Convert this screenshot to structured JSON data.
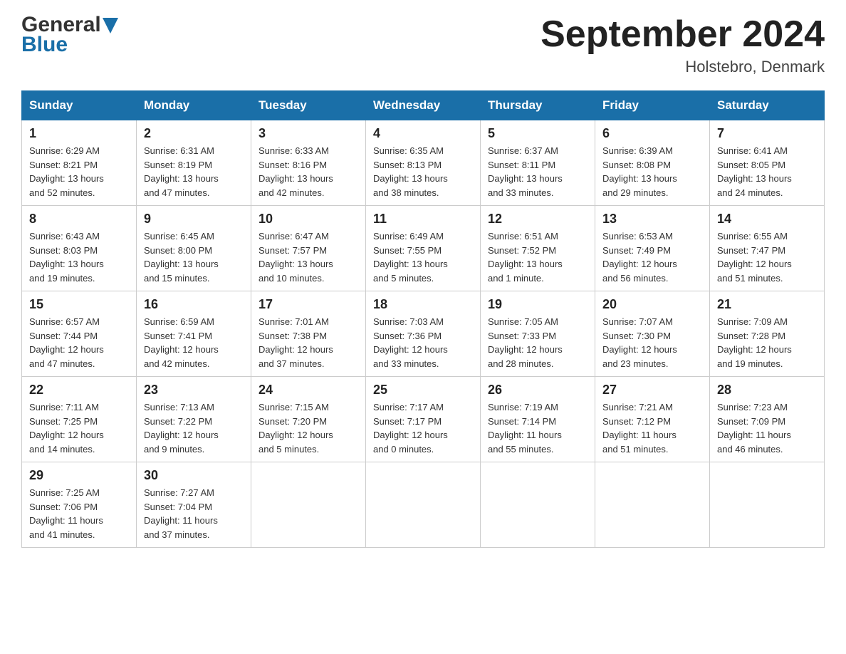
{
  "header": {
    "logo_line1": "General",
    "logo_line2": "Blue",
    "title": "September 2024",
    "location": "Holstebro, Denmark"
  },
  "weekdays": [
    "Sunday",
    "Monday",
    "Tuesday",
    "Wednesday",
    "Thursday",
    "Friday",
    "Saturday"
  ],
  "weeks": [
    [
      {
        "day": "1",
        "sunrise": "6:29 AM",
        "sunset": "8:21 PM",
        "daylight": "13 hours and 52 minutes."
      },
      {
        "day": "2",
        "sunrise": "6:31 AM",
        "sunset": "8:19 PM",
        "daylight": "13 hours and 47 minutes."
      },
      {
        "day": "3",
        "sunrise": "6:33 AM",
        "sunset": "8:16 PM",
        "daylight": "13 hours and 42 minutes."
      },
      {
        "day": "4",
        "sunrise": "6:35 AM",
        "sunset": "8:13 PM",
        "daylight": "13 hours and 38 minutes."
      },
      {
        "day": "5",
        "sunrise": "6:37 AM",
        "sunset": "8:11 PM",
        "daylight": "13 hours and 33 minutes."
      },
      {
        "day": "6",
        "sunrise": "6:39 AM",
        "sunset": "8:08 PM",
        "daylight": "13 hours and 29 minutes."
      },
      {
        "day": "7",
        "sunrise": "6:41 AM",
        "sunset": "8:05 PM",
        "daylight": "13 hours and 24 minutes."
      }
    ],
    [
      {
        "day": "8",
        "sunrise": "6:43 AM",
        "sunset": "8:03 PM",
        "daylight": "13 hours and 19 minutes."
      },
      {
        "day": "9",
        "sunrise": "6:45 AM",
        "sunset": "8:00 PM",
        "daylight": "13 hours and 15 minutes."
      },
      {
        "day": "10",
        "sunrise": "6:47 AM",
        "sunset": "7:57 PM",
        "daylight": "13 hours and 10 minutes."
      },
      {
        "day": "11",
        "sunrise": "6:49 AM",
        "sunset": "7:55 PM",
        "daylight": "13 hours and 5 minutes."
      },
      {
        "day": "12",
        "sunrise": "6:51 AM",
        "sunset": "7:52 PM",
        "daylight": "13 hours and 1 minute."
      },
      {
        "day": "13",
        "sunrise": "6:53 AM",
        "sunset": "7:49 PM",
        "daylight": "12 hours and 56 minutes."
      },
      {
        "day": "14",
        "sunrise": "6:55 AM",
        "sunset": "7:47 PM",
        "daylight": "12 hours and 51 minutes."
      }
    ],
    [
      {
        "day": "15",
        "sunrise": "6:57 AM",
        "sunset": "7:44 PM",
        "daylight": "12 hours and 47 minutes."
      },
      {
        "day": "16",
        "sunrise": "6:59 AM",
        "sunset": "7:41 PM",
        "daylight": "12 hours and 42 minutes."
      },
      {
        "day": "17",
        "sunrise": "7:01 AM",
        "sunset": "7:38 PM",
        "daylight": "12 hours and 37 minutes."
      },
      {
        "day": "18",
        "sunrise": "7:03 AM",
        "sunset": "7:36 PM",
        "daylight": "12 hours and 33 minutes."
      },
      {
        "day": "19",
        "sunrise": "7:05 AM",
        "sunset": "7:33 PM",
        "daylight": "12 hours and 28 minutes."
      },
      {
        "day": "20",
        "sunrise": "7:07 AM",
        "sunset": "7:30 PM",
        "daylight": "12 hours and 23 minutes."
      },
      {
        "day": "21",
        "sunrise": "7:09 AM",
        "sunset": "7:28 PM",
        "daylight": "12 hours and 19 minutes."
      }
    ],
    [
      {
        "day": "22",
        "sunrise": "7:11 AM",
        "sunset": "7:25 PM",
        "daylight": "12 hours and 14 minutes."
      },
      {
        "day": "23",
        "sunrise": "7:13 AM",
        "sunset": "7:22 PM",
        "daylight": "12 hours and 9 minutes."
      },
      {
        "day": "24",
        "sunrise": "7:15 AM",
        "sunset": "7:20 PM",
        "daylight": "12 hours and 5 minutes."
      },
      {
        "day": "25",
        "sunrise": "7:17 AM",
        "sunset": "7:17 PM",
        "daylight": "12 hours and 0 minutes."
      },
      {
        "day": "26",
        "sunrise": "7:19 AM",
        "sunset": "7:14 PM",
        "daylight": "11 hours and 55 minutes."
      },
      {
        "day": "27",
        "sunrise": "7:21 AM",
        "sunset": "7:12 PM",
        "daylight": "11 hours and 51 minutes."
      },
      {
        "day": "28",
        "sunrise": "7:23 AM",
        "sunset": "7:09 PM",
        "daylight": "11 hours and 46 minutes."
      }
    ],
    [
      {
        "day": "29",
        "sunrise": "7:25 AM",
        "sunset": "7:06 PM",
        "daylight": "11 hours and 41 minutes."
      },
      {
        "day": "30",
        "sunrise": "7:27 AM",
        "sunset": "7:04 PM",
        "daylight": "11 hours and 37 minutes."
      },
      null,
      null,
      null,
      null,
      null
    ]
  ],
  "labels": {
    "sunrise": "Sunrise:",
    "sunset": "Sunset:",
    "daylight": "Daylight:"
  }
}
